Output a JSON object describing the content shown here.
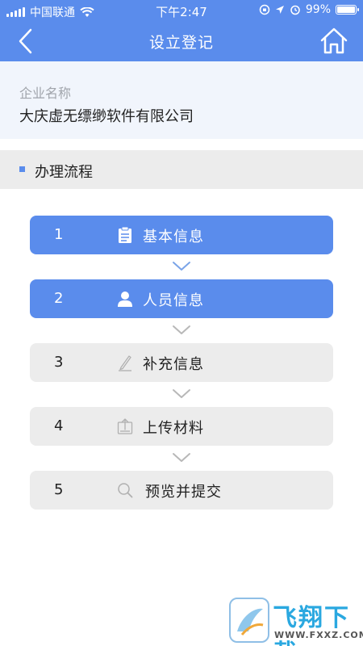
{
  "status_bar": {
    "carrier": "中国联通",
    "time": "下午2:47",
    "battery": "99%"
  },
  "nav": {
    "title": "设立登记",
    "back_icon": "chevron-left-icon",
    "home_icon": "home-icon"
  },
  "company": {
    "label": "企业名称",
    "name": "大庆虚无缥缈软件有限公司"
  },
  "section": {
    "title": "办理流程"
  },
  "steps": [
    {
      "number": "1",
      "label": "基本信息",
      "icon": "clipboard-icon",
      "active": true
    },
    {
      "number": "2",
      "label": "人员信息",
      "icon": "person-icon",
      "active": true
    },
    {
      "number": "3",
      "label": "补充信息",
      "icon": "pen-icon",
      "active": false
    },
    {
      "number": "4",
      "label": "上传材料",
      "icon": "upload-icon",
      "active": false
    },
    {
      "number": "5",
      "label": "预览并提交",
      "icon": "search-icon",
      "active": false
    }
  ],
  "watermark": {
    "title": "飞翔下载",
    "url": "WWW.FXXZ.COM"
  },
  "colors": {
    "primary": "#5a8cec",
    "step_inactive": "#ececec",
    "section_bg": "#ececec",
    "company_bg": "#f1f5fc",
    "chevron": "#a8c0e8"
  }
}
